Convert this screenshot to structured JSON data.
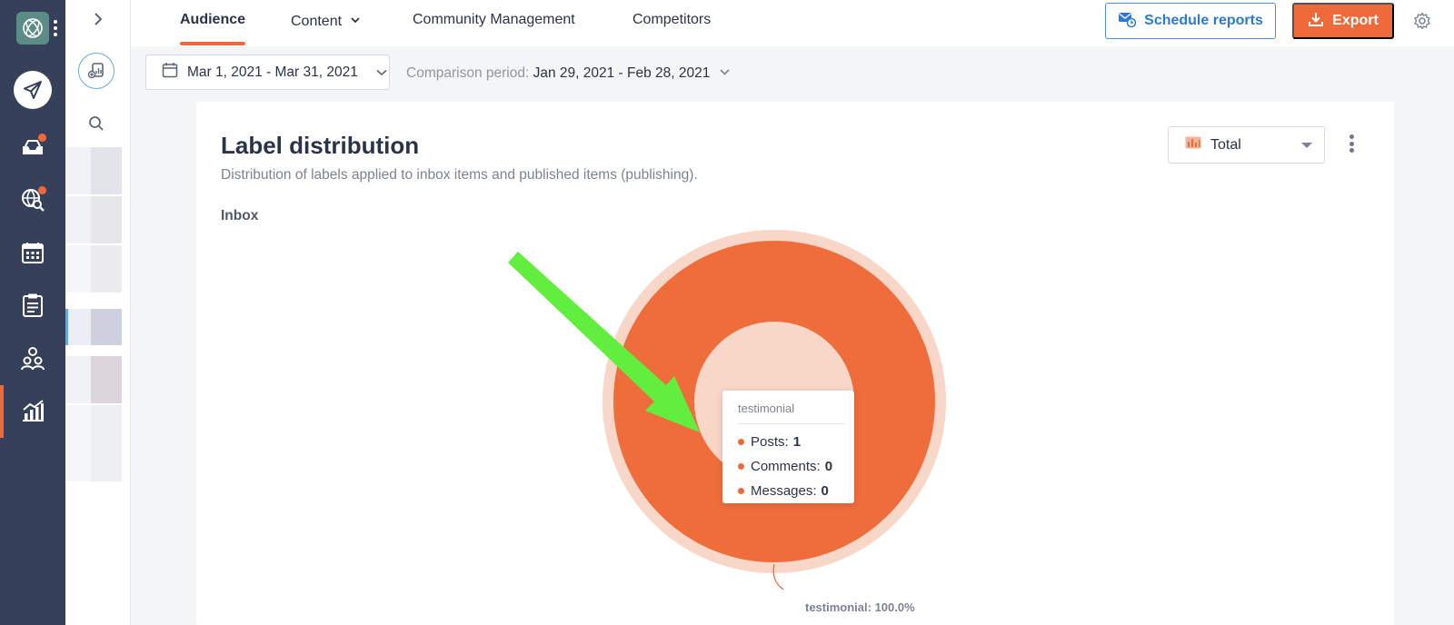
{
  "topbar": {
    "tabs": [
      {
        "label": "Audience",
        "active": true
      },
      {
        "label": "Content",
        "active": false
      },
      {
        "label": "Community Management",
        "active": false
      },
      {
        "label": "Competitors",
        "active": false
      }
    ],
    "schedule_label": "Schedule reports",
    "export_label": "Export"
  },
  "filters": {
    "date_range": "Mar 1, 2021 - Mar 31, 2021",
    "comparison_label": "Comparison period:",
    "comparison_value": "Jan 29, 2021 - Feb 28, 2021"
  },
  "card": {
    "title": "Label distribution",
    "subtitle": "Distribution of labels applied to inbox items and published items (publishing).",
    "section_label": "Inbox",
    "view_select": "Total"
  },
  "chart_data": {
    "type": "pie",
    "variant": "donut",
    "categories": [
      "testimonial"
    ],
    "values": [
      100.0
    ],
    "slice_label": "testimonial: 100.0%",
    "colors": {
      "slice": "#ef6d3b",
      "halo": "#f8d6c8"
    },
    "tooltip": {
      "title": "testimonial",
      "rows": [
        {
          "label": "Posts:",
          "value": "1"
        },
        {
          "label": "Comments:",
          "value": "0"
        },
        {
          "label": "Messages:",
          "value": "0"
        }
      ]
    }
  },
  "annotation": {
    "type": "arrow",
    "color": "#62ee3f"
  },
  "colors": {
    "accent": "#ef6a3a",
    "rail": "#36405b",
    "link_blue": "#2e7ad1"
  },
  "icons": {
    "rail": [
      "globe-logo-icon",
      "paper-plane-icon",
      "inbox-icon",
      "globe-search-icon",
      "calendar-icon",
      "clipboard-icon",
      "users-icon",
      "analytics-icon"
    ],
    "sidebar": [
      "chevron-right-icon",
      "report-add-icon",
      "search-icon"
    ]
  }
}
